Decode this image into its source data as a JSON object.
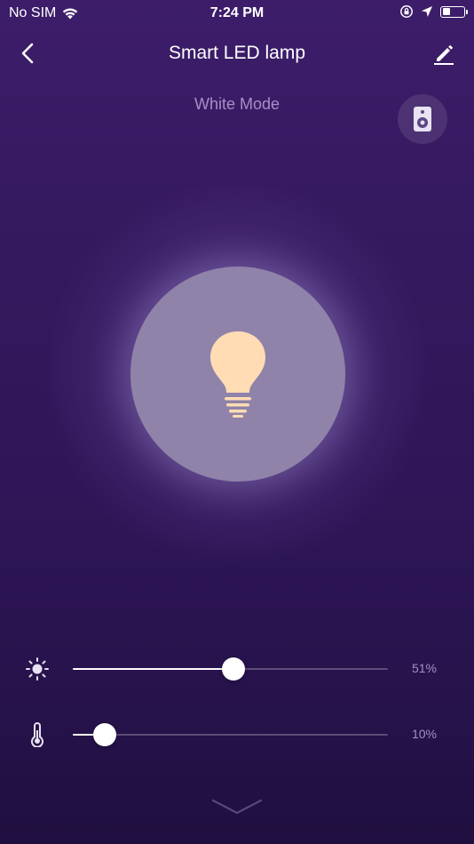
{
  "status_bar": {
    "carrier": "No SIM",
    "time": "7:24 PM",
    "battery_level": 0.45
  },
  "nav": {
    "title": "Smart LED lamp",
    "back_icon": "chevron-left-icon",
    "edit_icon": "pencil-icon"
  },
  "mode": {
    "label": "White Mode",
    "speaker_icon": "speaker-icon"
  },
  "lamp": {
    "icon": "light-bulb-icon",
    "bulb_color": "#ffdcb4",
    "circle_color": "#8f83a9"
  },
  "sliders": {
    "brightness": {
      "icon": "sun-icon",
      "value": 51,
      "value_text": "51%"
    },
    "temperature": {
      "icon": "thermometer-icon",
      "value": 10,
      "value_text": "10%"
    }
  },
  "footer": {
    "expand_icon": "chevron-down-icon"
  },
  "colors": {
    "accent_text": "#a58fc8",
    "background_top": "#3d1d6a",
    "background_bottom": "#1f0f3f"
  }
}
